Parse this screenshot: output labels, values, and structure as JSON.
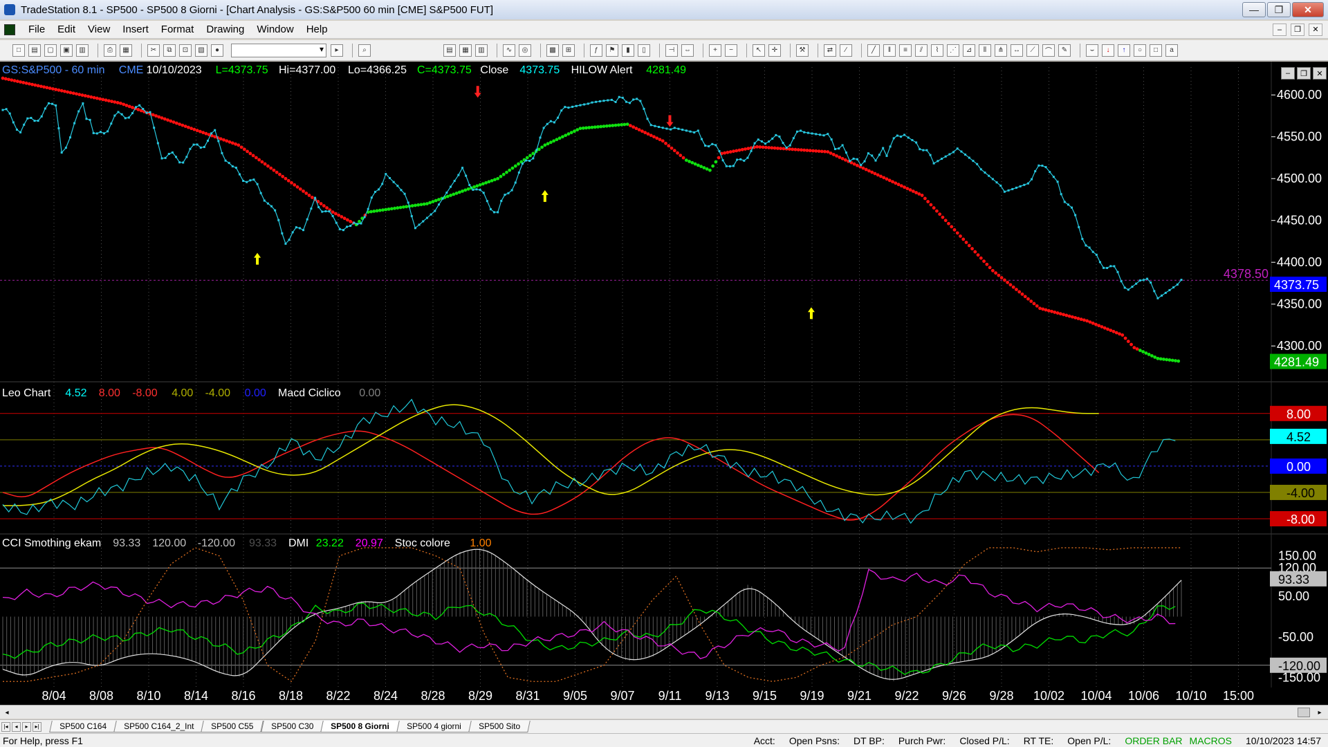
{
  "window": {
    "title": "TradeStation 8.1 - SP500 - SP500 8 Giorni - [Chart Analysis - GS:S&P500  60 min  [CME] S&P500 FUT]",
    "minimize": "—",
    "maximize": "❐",
    "close": "✕"
  },
  "menu": [
    "File",
    "Edit",
    "View",
    "Insert",
    "Format",
    "Drawing",
    "Window",
    "Help"
  ],
  "mdi_buttons": [
    "–",
    "❐",
    "✕"
  ],
  "chart_window_buttons": [
    "–",
    "❐",
    "✕"
  ],
  "price_panel": {
    "header": [
      {
        "text": "GS:S&P500 - 60 min",
        "color": "#4b8cff"
      },
      {
        "text": "CME",
        "color": "#4b8cff"
      },
      {
        "text": "10/10/2023",
        "color": "#ffffff"
      },
      {
        "text": "L=4373.75",
        "color": "#00ff00"
      },
      {
        "text": "Hi=4377.00",
        "color": "#ffffff"
      },
      {
        "text": "Lo=4366.25",
        "color": "#ffffff"
      },
      {
        "text": "C=4373.75",
        "color": "#00ff00"
      },
      {
        "text": "Close",
        "color": "#ffffff"
      },
      {
        "text": "4373.75",
        "color": "#00ffff"
      },
      {
        "text": "HILOW Alert",
        "color": "#ffffff"
      },
      {
        "text": "4281.49",
        "color": "#00ff00"
      }
    ],
    "y_ticks": [
      "4600.00",
      "4550.00",
      "4500.00",
      "4450.00",
      "4400.00",
      "4350.00",
      "4300.00"
    ],
    "tags": [
      {
        "text": "4373.75",
        "fg": "#ffffff",
        "bg": "#0000ff",
        "value": 4373.75
      },
      {
        "text": "4281.49",
        "fg": "#ffffff",
        "bg": "#00b000",
        "value": 4281.49
      }
    ],
    "alert_line_label": "4378.50",
    "alert_line_value": 4378.5
  },
  "macd_panel": {
    "header": [
      {
        "text": "Leo Chart",
        "color": "#ffffff"
      },
      {
        "text": "4.52",
        "color": "#00ffff"
      },
      {
        "text": "8.00",
        "color": "#ff3030"
      },
      {
        "text": "-8.00",
        "color": "#ff3030"
      },
      {
        "text": "4.00",
        "color": "#b0b000"
      },
      {
        "text": "-4.00",
        "color": "#b0b000"
      },
      {
        "text": "0.00",
        "color": "#2020ff"
      },
      {
        "text": "Macd Ciclico",
        "color": "#ffffff"
      },
      {
        "text": "0.00",
        "color": "#808080"
      }
    ],
    "tags": [
      {
        "text": "8.00",
        "fg": "#ffffff",
        "bg": "#d00000",
        "value": 8
      },
      {
        "text": "4.52",
        "fg": "#000000",
        "bg": "#00ffff",
        "value": 4.52
      },
      {
        "text": "0.00",
        "fg": "#ffffff",
        "bg": "#0000ff",
        "value": 0
      },
      {
        "text": "-4.00",
        "fg": "#000000",
        "bg": "#808000",
        "value": -4
      },
      {
        "text": "-8.00",
        "fg": "#ffffff",
        "bg": "#d00000",
        "value": -8
      }
    ]
  },
  "cci_panel": {
    "header": [
      {
        "text": "CCI Smothing ekam",
        "color": "#ffffff"
      },
      {
        "text": "93.33",
        "color": "#c0c0c0"
      },
      {
        "text": "120.00",
        "color": "#c0c0c0"
      },
      {
        "text": "-120.00",
        "color": "#c0c0c0"
      },
      {
        "text": "93.33",
        "color": "#505050"
      },
      {
        "text": "DMI",
        "color": "#ffffff"
      },
      {
        "text": "23.22",
        "color": "#00ff00"
      },
      {
        "text": "20.97",
        "color": "#ff00ff"
      },
      {
        "text": "Stoc colore",
        "color": "#ffffff"
      },
      {
        "text": "1.00",
        "color": "#ff8000"
      }
    ],
    "y_ticks": [
      "150.00",
      "120.00",
      "50.00",
      "-50.00",
      "-120.00",
      "-150.00"
    ],
    "tags": [
      {
        "text": "93.33",
        "fg": "#000000",
        "bg": "#c0c0c0",
        "value": 93.33
      },
      {
        "text": "-120.00",
        "fg": "#000000",
        "bg": "#c0c0c0",
        "value": -120
      }
    ]
  },
  "x_axis": [
    "8/04",
    "8/08",
    "8/10",
    "8/14",
    "8/16",
    "8/18",
    "8/22",
    "8/24",
    "8/28",
    "8/29",
    "8/31",
    "9/05",
    "9/07",
    "9/11",
    "9/13",
    "9/15",
    "9/19",
    "9/21",
    "9/22",
    "9/26",
    "9/28",
    "10/02",
    "10/04",
    "10/06",
    "10/10",
    "15:00"
  ],
  "tabs": [
    "SP500 C164",
    "SP500 C164_2_Int",
    "SP500 C55",
    "SP500 C30",
    "SP500 8 Giorni",
    "SP500 4 giorni",
    "SP500 Sito"
  ],
  "active_tab": "SP500 8 Giorni",
  "status": {
    "help": "For Help, press F1",
    "fields": [
      "Acct:",
      "Open Psns:",
      "DT BP:",
      "Purch Pwr:",
      "Closed P/L:",
      "RT TE:",
      "Open P/L:"
    ],
    "order_bar": "ORDER BAR",
    "macros": "MACROS",
    "datetime": "10/10/2023 14:57"
  },
  "colors": {
    "price_line": "#28c8e0",
    "stop_down": "#ff1010",
    "stop_up": "#10e010",
    "arrow_up": "#ffff00",
    "arrow_down": "#ff2020",
    "macd_red": "#ff2020",
    "macd_yellow": "#e8e800",
    "macd_cyan": "#20c8d8",
    "cci_white": "#e0e0e0",
    "dmi_green": "#00e000",
    "dmi_magenta": "#e020e0",
    "stoc_orange": "#e07020"
  },
  "chart_data": [
    {
      "type": "line",
      "panel": "price",
      "ylim": [
        4258,
        4625
      ],
      "x_range": [
        0,
        100
      ],
      "series": [
        {
          "name": "Close",
          "points": [
            [
              0,
              4582
            ],
            [
              1.5,
              4560
            ],
            [
              3,
              4575
            ],
            [
              4.5,
              4590
            ],
            [
              5,
              4532
            ],
            [
              6.8,
              4585
            ],
            [
              8,
              4548
            ],
            [
              9.5,
              4572
            ],
            [
              11,
              4580
            ],
            [
              12.5,
              4585
            ],
            [
              13.5,
              4530
            ],
            [
              15,
              4522
            ],
            [
              16.5,
              4538
            ],
            [
              18,
              4552
            ],
            [
              19.5,
              4510
            ],
            [
              21,
              4498
            ],
            [
              22.5,
              4475
            ],
            [
              24,
              4428
            ],
            [
              25.5,
              4441
            ],
            [
              26.5,
              4476
            ],
            [
              28,
              4450
            ],
            [
              29.5,
              4438
            ],
            [
              31,
              4462
            ],
            [
              32.5,
              4509
            ],
            [
              33.5,
              4497
            ],
            [
              35,
              4446
            ],
            [
              37,
              4468
            ],
            [
              39,
              4507
            ],
            [
              40.5,
              4482
            ],
            [
              42,
              4460
            ],
            [
              43.5,
              4500
            ],
            [
              45,
              4530
            ],
            [
              46.5,
              4571
            ],
            [
              48,
              4582
            ],
            [
              50,
              4585
            ],
            [
              52,
              4590
            ],
            [
              53.5,
              4598
            ],
            [
              55,
              4570
            ],
            [
              57,
              4563
            ],
            [
              59,
              4553
            ],
            [
              60.5,
              4534
            ],
            [
              62,
              4512
            ],
            [
              63.5,
              4535
            ],
            [
              65,
              4550
            ],
            [
              66.5,
              4542
            ],
            [
              68,
              4556
            ],
            [
              70,
              4548
            ],
            [
              72.5,
              4520
            ],
            [
              75,
              4532
            ],
            [
              76.5,
              4558
            ],
            [
              77.5,
              4547
            ],
            [
              79,
              4517
            ],
            [
              81,
              4530
            ],
            [
              83,
              4508
            ],
            [
              85,
              4488
            ],
            [
              87,
              4500
            ],
            [
              88.5,
              4516
            ],
            [
              89.5,
              4495
            ],
            [
              91,
              4451
            ],
            [
              92.5,
              4407
            ],
            [
              94,
              4394
            ],
            [
              95.5,
              4371
            ],
            [
              96.5,
              4384
            ],
            [
              98,
              4362
            ],
            [
              100,
              4379
            ]
          ]
        },
        {
          "name": "HILOW Alert",
          "points": [
            [
              0,
              4620
            ],
            [
              10,
              4590
            ],
            [
              20,
              4540
            ],
            [
              28,
              4460
            ],
            [
              30,
              4445
            ],
            [
              31,
              4460
            ],
            [
              36,
              4470
            ],
            [
              42,
              4500
            ],
            [
              46,
              4540
            ],
            [
              49,
              4560
            ],
            [
              53,
              4565
            ],
            [
              56,
              4545
            ],
            [
              58,
              4522
            ],
            [
              60,
              4510
            ],
            [
              61,
              4530
            ],
            [
              64,
              4538
            ],
            [
              70,
              4532
            ],
            [
              78,
              4480
            ],
            [
              84,
              4390
            ],
            [
              88,
              4345
            ],
            [
              92,
              4330
            ],
            [
              95,
              4313
            ],
            [
              96,
              4298
            ],
            [
              98,
              4285
            ],
            [
              100,
              4281.49
            ]
          ]
        }
      ],
      "markers": [
        {
          "type": "arrow-up",
          "x": 21.6,
          "y": 4403
        },
        {
          "type": "arrow-down",
          "x": 40.3,
          "y": 4605
        },
        {
          "type": "arrow-up",
          "x": 46,
          "y": 4478
        },
        {
          "type": "arrow-down",
          "x": 56.6,
          "y": 4570
        },
        {
          "type": "arrow-up",
          "x": 68.6,
          "y": 4338
        }
      ]
    },
    {
      "type": "line",
      "panel": "macd",
      "ylim": [
        -10,
        10.5
      ],
      "levels": [
        8,
        4,
        0,
        -4,
        -8
      ],
      "series": [
        {
          "name": "",
          "values": [
            -4,
            -5,
            -3,
            -1,
            0.5,
            1.8,
            2.5,
            3,
            1.5,
            -0.5,
            -2,
            -1,
            1,
            2.5,
            4,
            5,
            5.5,
            4.5,
            3,
            1,
            -1,
            -3,
            -5,
            -7,
            -7.5,
            -6,
            -4,
            -1,
            2,
            4,
            4.5,
            3,
            1,
            -1,
            -3,
            -4.5,
            -6,
            -7.5,
            -8.5,
            -7,
            -4,
            -1,
            2.5,
            5,
            7,
            8,
            7.5,
            5,
            2,
            -1
          ]
        },
        {
          "name": "",
          "values": [
            -6,
            -6,
            -5.5,
            -4,
            -2,
            -0.5,
            1.5,
            3,
            3.5,
            3,
            2,
            0.5,
            -1,
            -1.5,
            -1,
            1,
            3,
            5,
            7,
            8.5,
            9.5,
            9,
            7.5,
            5,
            2,
            -1,
            -3,
            -4.5,
            -4,
            -2,
            0,
            1.5,
            2.5,
            2.5,
            1.5,
            0,
            -1.5,
            -3,
            -4,
            -4.5,
            -4,
            -2,
            1,
            4,
            7,
            8.5,
            9,
            8.5,
            8,
            8
          ]
        },
        {
          "name": "",
          "values": [
            -6,
            -7,
            -5.5,
            -6,
            -4,
            -3,
            -1,
            0,
            -2,
            -6,
            -2,
            0,
            4,
            1,
            3,
            7,
            8,
            9.5,
            7,
            6,
            4,
            -3,
            -5,
            -3,
            -2.5,
            -1,
            0,
            -1,
            2,
            3,
            1,
            -1,
            -1.5,
            -3,
            -6,
            -7.5,
            -8,
            -7.5,
            -8,
            -4,
            -1,
            -1.5,
            -2,
            -2,
            -1.5,
            -1,
            0.5,
            -2.5,
            3,
            5
          ]
        }
      ]
    },
    {
      "type": "line",
      "panel": "cci",
      "ylim": [
        -175,
        175
      ],
      "levels": [
        120,
        -120
      ],
      "series": [
        {
          "name": "",
          "values": [
            -130,
            -150,
            -120,
            -110,
            -125,
            -100,
            -90,
            -95,
            -110,
            -140,
            -150,
            -90,
            -30,
            10,
            20,
            40,
            30,
            80,
            120,
            160,
            170,
            130,
            80,
            40,
            0,
            -80,
            -110,
            -100,
            -60,
            -20,
            30,
            80,
            40,
            -20,
            -60,
            -100,
            -140,
            -160,
            -140,
            -120,
            -110,
            -100,
            -60,
            -10,
            10,
            0,
            -20,
            -20,
            30,
            90
          ]
        },
        {
          "name": "DMI",
          "values": [
            -100,
            -90,
            -70,
            -60,
            -50,
            -55,
            -40,
            -30,
            -50,
            -70,
            -90,
            -60,
            -30,
            20,
            10,
            30,
            20,
            10,
            0,
            30,
            10,
            -20,
            -60,
            -80,
            -70,
            -60,
            -40,
            -50,
            -20,
            20,
            0,
            -30,
            -60,
            -80,
            -90,
            -110,
            -120,
            -130,
            -140,
            -120,
            -90,
            -70,
            -80,
            -70,
            -50,
            -60,
            -40,
            -40,
            20,
            30
          ]
        },
        {
          "name": "DMI",
          "values": [
            40,
            60,
            50,
            70,
            80,
            60,
            40,
            30,
            30,
            40,
            60,
            70,
            40,
            0,
            -20,
            -10,
            -30,
            -40,
            -60,
            -80,
            -70,
            -80,
            -60,
            -50,
            -40,
            -20,
            -40,
            -60,
            -80,
            -100,
            -70,
            -40,
            -30,
            -60,
            -70,
            -80,
            110,
            90,
            100,
            80,
            100,
            60,
            40,
            20,
            30,
            20,
            0,
            -10,
            0,
            -20
          ]
        },
        {
          "name": "Stoc colore",
          "values": [
            -160,
            -160,
            -150,
            -140,
            -120,
            -60,
            40,
            130,
            170,
            150,
            40,
            -120,
            -160,
            -60,
            150,
            170,
            170,
            170,
            150,
            120,
            -40,
            -150,
            -160,
            -160,
            -140,
            -120,
            -40,
            40,
            100,
            -20,
            -120,
            -150,
            -160,
            -150,
            -120,
            -100,
            -60,
            -20,
            0,
            60,
            130,
            170,
            170,
            160,
            170,
            170,
            165,
            170,
            170,
            170
          ]
        }
      ]
    }
  ]
}
